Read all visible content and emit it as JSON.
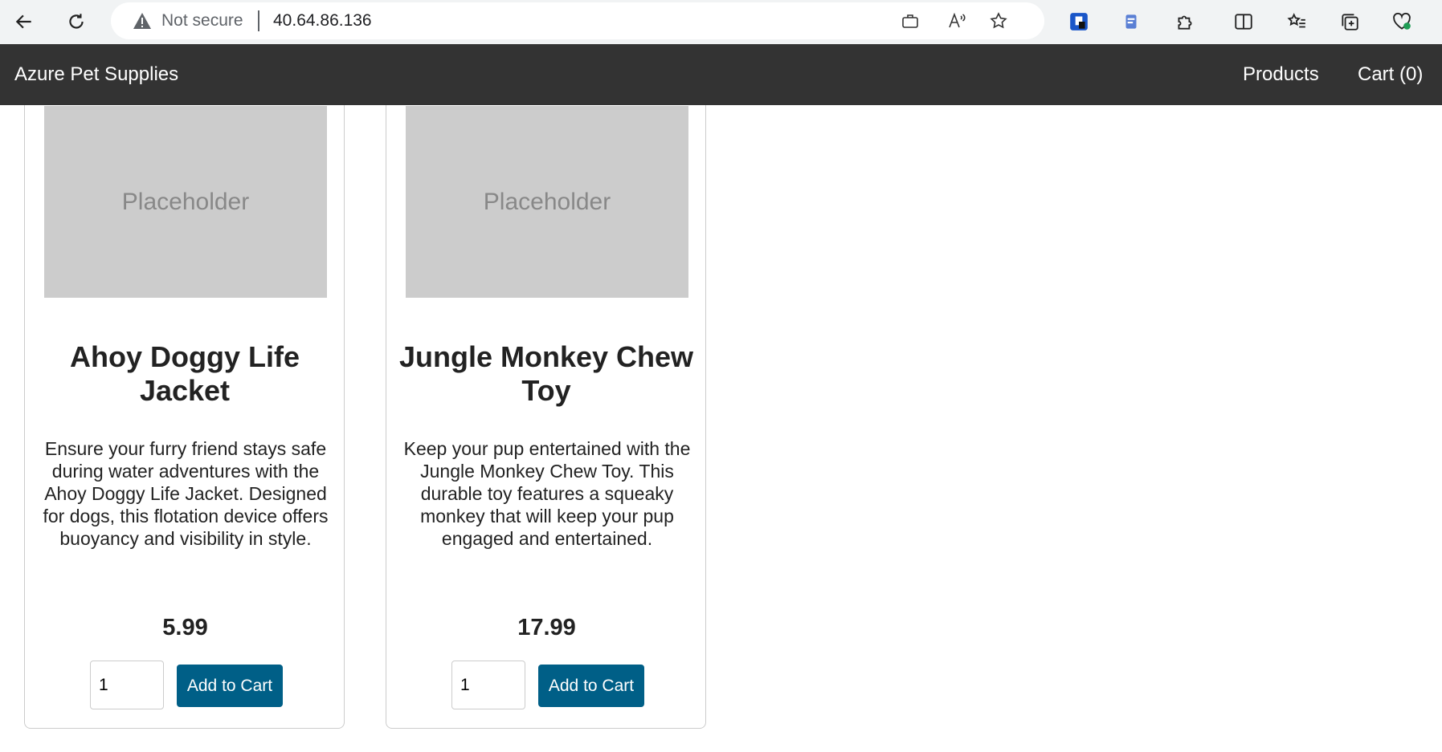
{
  "browser": {
    "security_label": "Not secure",
    "url": "40.64.86.136"
  },
  "site": {
    "brand": "Azure Pet Supplies",
    "nav": {
      "products": "Products",
      "cart": "Cart (0)"
    }
  },
  "products": [
    {
      "image_label": "Placeholder",
      "title": "Ahoy Doggy Life Jacket",
      "description": "Ensure your furry friend stays safe during water adventures with the Ahoy Doggy Life Jacket. Designed for dogs, this flotation device offers buoyancy and visibility in style.",
      "price": "5.99",
      "quantity": "1",
      "button_label": "Add to Cart"
    },
    {
      "image_label": "Placeholder",
      "title": "Jungle Monkey Chew Toy",
      "description": "Keep your pup entertained with the Jungle Monkey Chew Toy. This durable toy features a squeaky monkey that will keep your pup engaged and entertained.",
      "price": "17.99",
      "quantity": "1",
      "button_label": "Add to Cart"
    }
  ],
  "colors": {
    "navbar": "#333333",
    "button": "#005f87",
    "placeholder": "#cccccc"
  }
}
